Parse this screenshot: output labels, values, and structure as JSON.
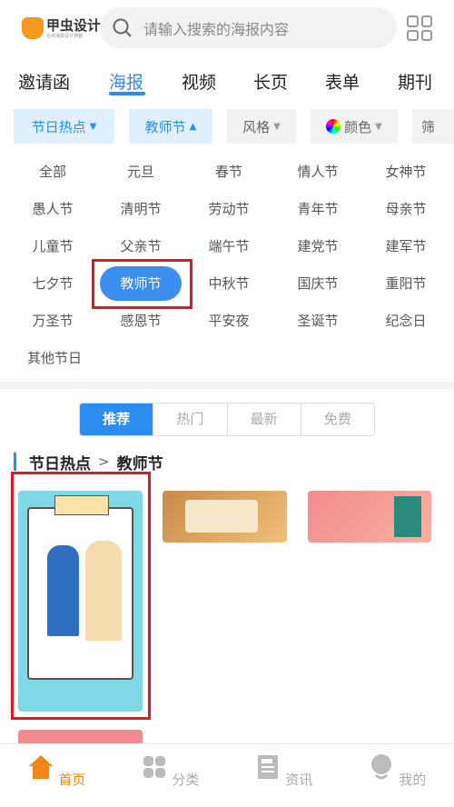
{
  "header": {
    "logo_text": "甲虫设计",
    "logo_sub": "在线海报设计神器",
    "search_placeholder": "请输入搜索的海报内容"
  },
  "nav": {
    "tabs": [
      {
        "label": "邀请函"
      },
      {
        "label": "海报",
        "active": true
      },
      {
        "label": "视频"
      },
      {
        "label": "长页"
      },
      {
        "label": "表单"
      },
      {
        "label": "期刊"
      }
    ]
  },
  "filters": [
    {
      "label": "节日热点",
      "caret": "▼"
    },
    {
      "label": "教师节",
      "caret": "▲"
    },
    {
      "label": "风格",
      "caret": "▼"
    },
    {
      "label": "颜色",
      "caret": "▼"
    },
    {
      "label": "筛"
    }
  ],
  "holidays": [
    "全部",
    "元旦",
    "春节",
    "情人节",
    "女神节",
    "愚人节",
    "清明节",
    "劳动节",
    "青年节",
    "母亲节",
    "儿童节",
    "父亲节",
    "端午节",
    "建党节",
    "建军节",
    "七夕节",
    "教师节",
    "中秋节",
    "国庆节",
    "重阳节",
    "万圣节",
    "感恩节",
    "平安夜",
    "圣诞节",
    "纪念日",
    "其他节日"
  ],
  "selected_holiday": "教师节",
  "sort_tabs": [
    {
      "label": "推荐",
      "active": true
    },
    {
      "label": "热门"
    },
    {
      "label": "最新"
    },
    {
      "label": "免费"
    }
  ],
  "breadcrumb": {
    "parent": "节日热点",
    "sep": ">",
    "current": "教师节"
  },
  "bottom_nav": [
    {
      "label": "首页",
      "icon": "home-icon",
      "active": true
    },
    {
      "label": "分类",
      "icon": "category-icon"
    },
    {
      "label": "资讯",
      "icon": "news-icon"
    },
    {
      "label": "我的",
      "icon": "profile-icon"
    }
  ],
  "colors": {
    "accent": "#2d8cf0",
    "highlight": "#e8141b",
    "active_bottom": "#f08519"
  }
}
